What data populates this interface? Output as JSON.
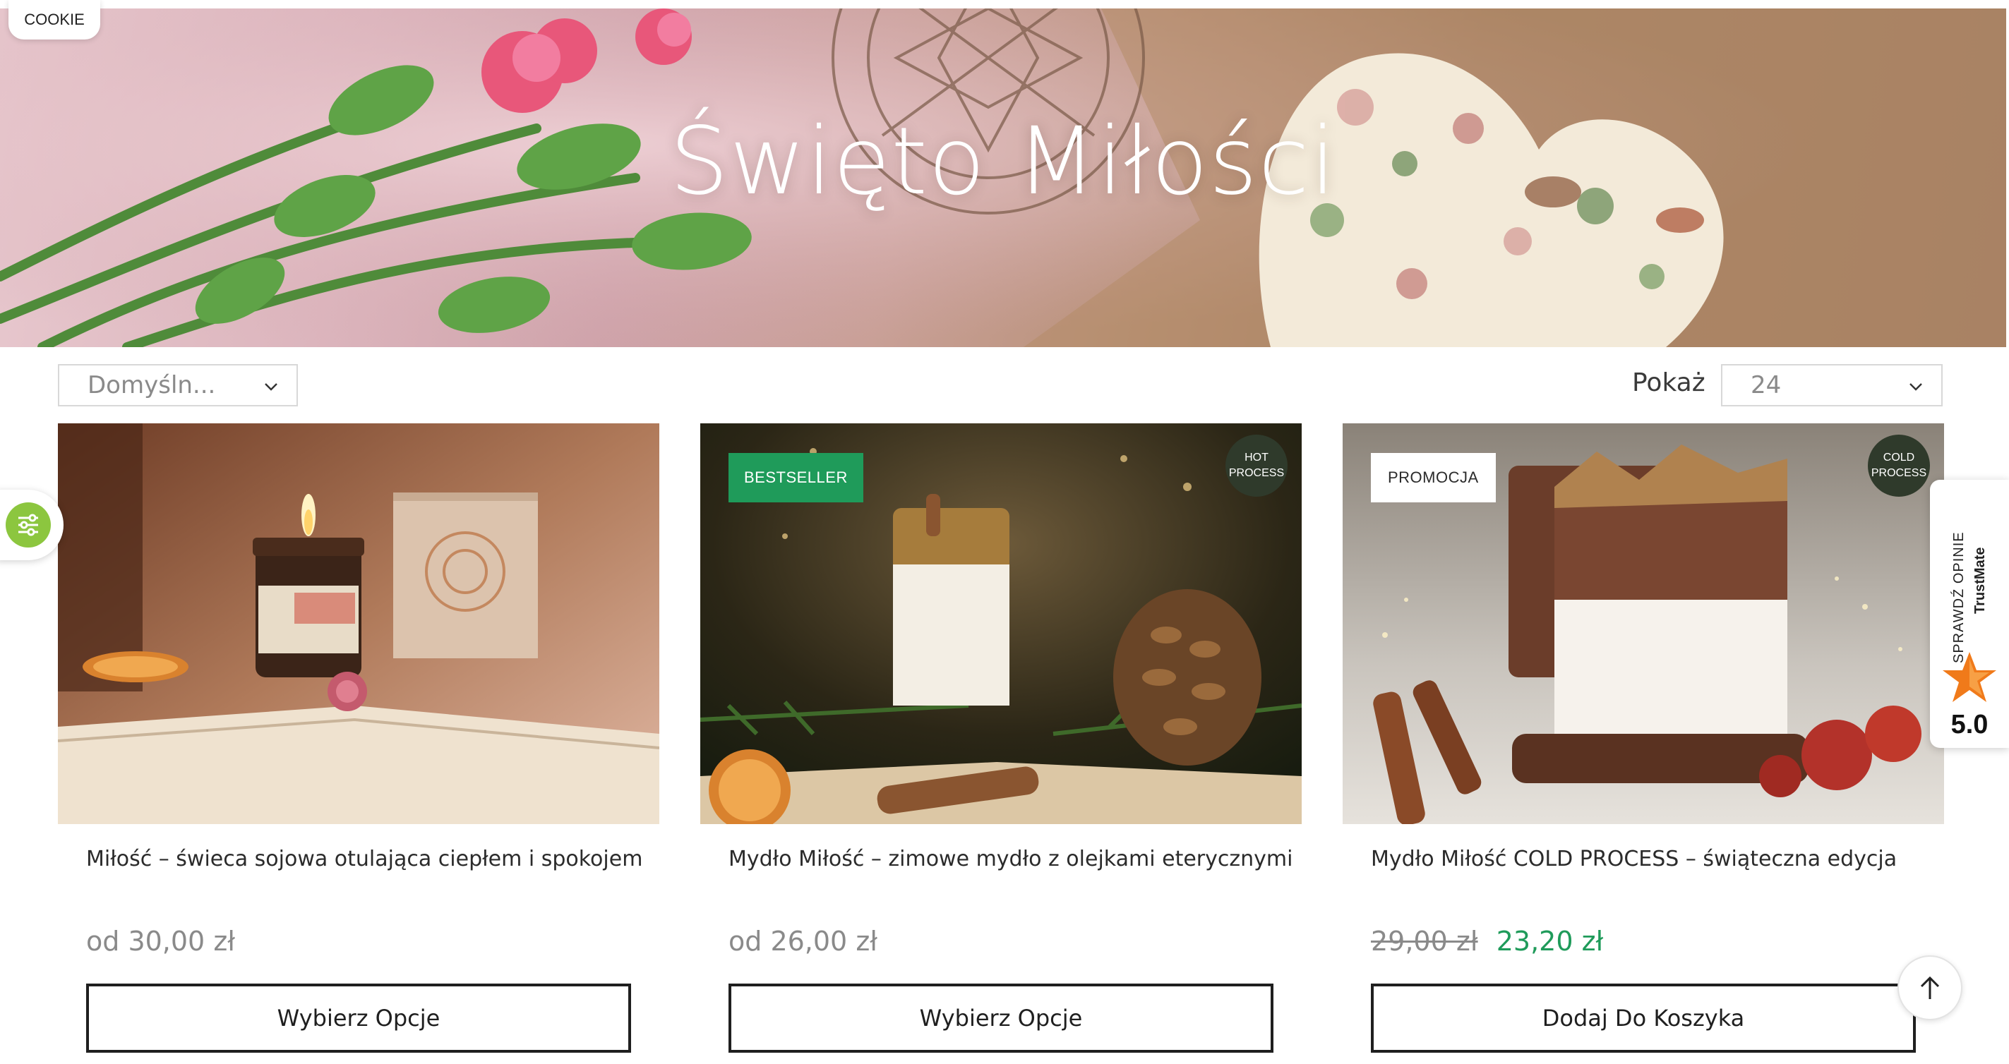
{
  "cookie": {
    "label": "COOKIE"
  },
  "hero": {
    "title": "Święto Miłości"
  },
  "toolbar": {
    "sort_value": "Domyśln...",
    "show_label": "Pokaż",
    "per_page_value": "24"
  },
  "products": [
    {
      "title": "Miłość – świeca sojowa otulająca ciepłem i spokojem",
      "price": "od 30,00 zł",
      "button": "Wybierz Opcje"
    },
    {
      "badge": "BESTSELLER",
      "process_badge": [
        "HOT",
        "PROCESS"
      ],
      "title": "Mydło Miłość – zimowe mydło z olejkami eterycznymi",
      "price": "od 26,00 zł",
      "button": "Wybierz Opcje"
    },
    {
      "badge": "PROMOCJA",
      "process_badge": [
        "COLD",
        "PROCESS"
      ],
      "title": "Mydło Miłość COLD PROCESS – świąteczna edycja",
      "old_price": "29,00 zł",
      "new_price": "23,20 zł",
      "button": "Dodaj Do Koszyka"
    }
  ],
  "trust_widget": {
    "label": "SPRAWDŹ OPINIE",
    "brand": "TrustMate",
    "score": "5.0"
  },
  "colors": {
    "accent_green": "#1f9b5a",
    "filter_green": "#8cc63f",
    "badge_dark": "#2f3a2b",
    "button_border": "#1f1f1f"
  },
  "icons": {
    "filter": "sliders-icon",
    "scroll_top": "arrow-up-icon",
    "chevron": "chevron-down-icon",
    "rating": "star-icon"
  }
}
